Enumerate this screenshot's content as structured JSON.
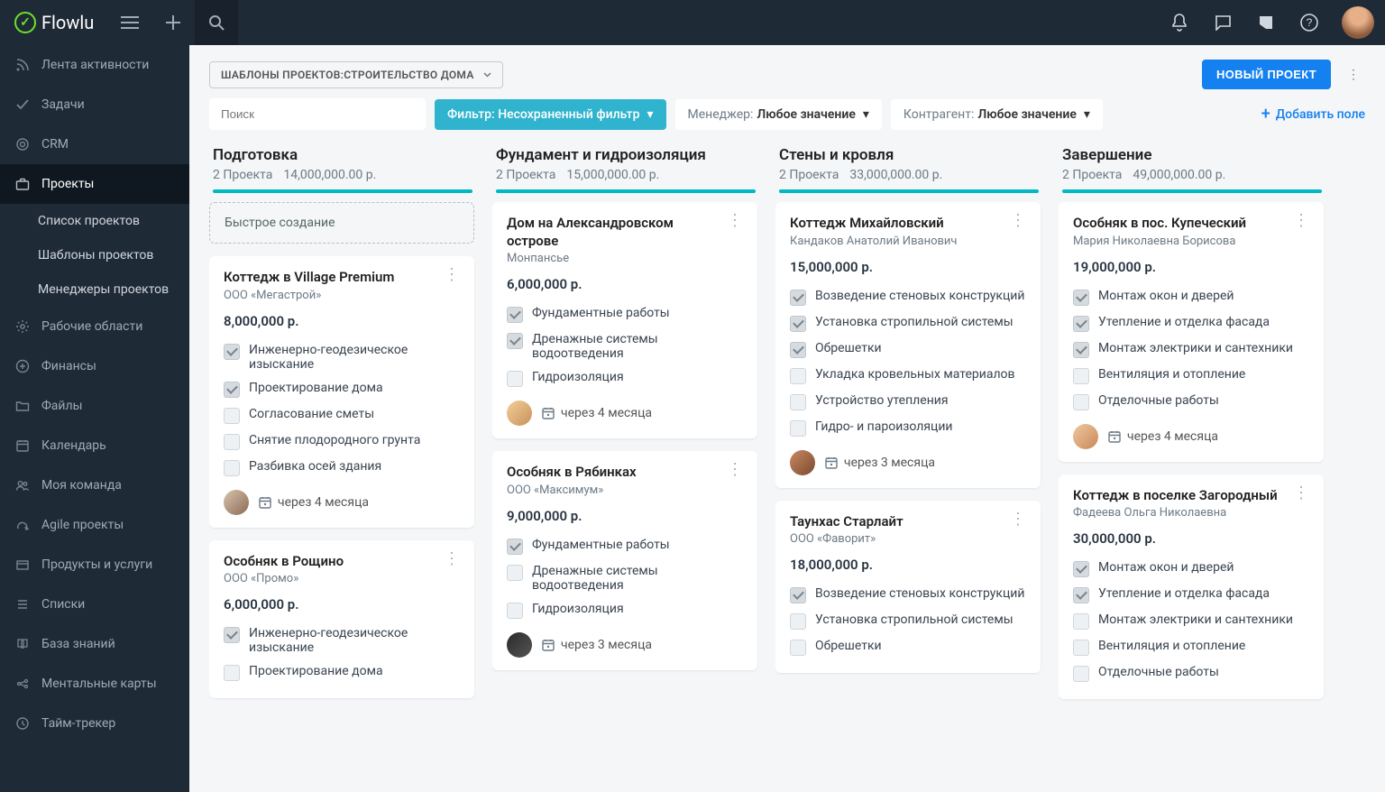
{
  "brand": "Flowlu",
  "sidebar": {
    "items": [
      {
        "label": "Лента активности",
        "icon": "rss"
      },
      {
        "label": "Задачи",
        "icon": "check"
      },
      {
        "label": "CRM",
        "icon": "target"
      },
      {
        "label": "Проекты",
        "icon": "briefcase",
        "active": true,
        "subs": [
          {
            "label": "Список проектов"
          },
          {
            "label": "Шаблоны проектов"
          },
          {
            "label": "Менеджеры проектов"
          }
        ]
      },
      {
        "label": "Рабочие области",
        "icon": "gear"
      },
      {
        "label": "Финансы",
        "icon": "plus-circle"
      },
      {
        "label": "Файлы",
        "icon": "folder"
      },
      {
        "label": "Календарь",
        "icon": "calendar"
      },
      {
        "label": "Моя команда",
        "icon": "users"
      },
      {
        "label": "Agile проекты",
        "icon": "agile"
      },
      {
        "label": "Продукты и услуги",
        "icon": "box"
      },
      {
        "label": "Списки",
        "icon": "list"
      },
      {
        "label": "База знаний",
        "icon": "book"
      },
      {
        "label": "Ментальные карты",
        "icon": "brain"
      },
      {
        "label": "Тайм-трекер",
        "icon": "clock"
      }
    ]
  },
  "toolbar": {
    "breadcrumb": "ШАБЛОНЫ ПРОЕКТОВ:СТРОИТЕЛЬСТВО ДОМА",
    "new_project": "НОВЫЙ ПРОЕКТ"
  },
  "filters": {
    "search_placeholder": "Поиск",
    "filter_label": "Фильтр: Несохраненный фильтр",
    "manager_label": "Менеджер:",
    "manager_value": "Любое значение",
    "counterparty_label": "Контрагент:",
    "counterparty_value": "Любое значение",
    "add_field": "Добавить поле"
  },
  "board": {
    "quick_create": "Быстрое создание",
    "columns": [
      {
        "title": "Подготовка",
        "count": "2 Проекта",
        "sum": "14,000,000.00 р.",
        "quick": true,
        "cards": [
          {
            "title": "Коттедж в Village Premium",
            "client": "ООО «Мегастрой»",
            "amount": "8,000,000 р.",
            "tasks": [
              {
                "t": "Инженерно-геодезическое изыскание",
                "done": true
              },
              {
                "t": "Проектирование дома",
                "done": true
              },
              {
                "t": "Согласование сметы",
                "done": false
              },
              {
                "t": "Снятие плодородного грунта",
                "done": false
              },
              {
                "t": "Разбивка осей здания",
                "done": false
              }
            ],
            "due": "через 4 месяца",
            "avatar": "a"
          },
          {
            "title": "Особняк в Рощино",
            "client": "ООО «Промо»",
            "amount": "6,000,000 р.",
            "tasks": [
              {
                "t": "Инженерно-геодезическое изыскание",
                "done": true
              },
              {
                "t": "Проектирование дома",
                "done": false
              }
            ]
          }
        ]
      },
      {
        "title": "Фундамент и гидроизоляция",
        "count": "2 Проекта",
        "sum": "15,000,000.00 р.",
        "cards": [
          {
            "title": "Дом на Александровском острове",
            "client": "Монпансье",
            "amount": "6,000,000 р.",
            "tasks": [
              {
                "t": "Фундаментные работы",
                "done": true
              },
              {
                "t": "Дренажные системы водоотведения",
                "done": true
              },
              {
                "t": "Гидроизоляция",
                "done": false
              }
            ],
            "due": "через 4 месяца",
            "avatar": "b"
          },
          {
            "title": "Особняк в Рябинках",
            "client": "ООО «Максимум»",
            "amount": "9,000,000 р.",
            "tasks": [
              {
                "t": "Фундаментные работы",
                "done": true
              },
              {
                "t": "Дренажные системы водоотведения",
                "done": false
              },
              {
                "t": "Гидроизоляция",
                "done": false
              }
            ],
            "due": "через 3 месяца",
            "avatar": "c"
          }
        ]
      },
      {
        "title": "Стены и кровля",
        "count": "2 Проекта",
        "sum": "33,000,000.00 р.",
        "cards": [
          {
            "title": "Коттедж Михайловский",
            "client": "Кандаков Анатолий Иванович",
            "amount": "15,000,000 р.",
            "tasks": [
              {
                "t": "Возведение стеновых конструкций",
                "done": true
              },
              {
                "t": "Установка стропильной системы",
                "done": true
              },
              {
                "t": "Обрешетки",
                "done": true
              },
              {
                "t": "Укладка кровельных материалов",
                "done": false
              },
              {
                "t": "Устройство утепления",
                "done": false
              },
              {
                "t": "Гидро- и пароизоляции",
                "done": false
              }
            ],
            "due": "через 3 месяца",
            "avatar": "d"
          },
          {
            "title": "Таунхас Старлайт",
            "client": "ООО «Фаворит»",
            "amount": "18,000,000 р.",
            "tasks": [
              {
                "t": "Возведение стеновых конструкций",
                "done": true
              },
              {
                "t": "Установка стропильной системы",
                "done": false
              },
              {
                "t": "Обрешетки",
                "done": false
              }
            ]
          }
        ]
      },
      {
        "title": "Завершение",
        "count": "2 Проекта",
        "sum": "49,000,000.00 р.",
        "cards": [
          {
            "title": "Особняк в пос. Купеческий",
            "client": "Мария Николаевна Борисова",
            "amount": "19,000,000 р.",
            "tasks": [
              {
                "t": "Монтаж окон и дверей",
                "done": true
              },
              {
                "t": "Утепление и отделка фасада",
                "done": true
              },
              {
                "t": "Монтаж электрики и сантехники",
                "done": true
              },
              {
                "t": "Вентиляция и отопление",
                "done": false
              },
              {
                "t": "Отделочные работы",
                "done": false
              }
            ],
            "due": "через 4 месяца",
            "avatar": "e"
          },
          {
            "title": "Коттедж в поселке Загородный",
            "client": "Фадеева Ольга Николаевна",
            "amount": "30,000,000 р.",
            "tasks": [
              {
                "t": "Монтаж окон и дверей",
                "done": true
              },
              {
                "t": "Утепление и отделка фасада",
                "done": true
              },
              {
                "t": "Монтаж электрики и сантехники",
                "done": false
              },
              {
                "t": "Вентиляция и отопление",
                "done": false
              },
              {
                "t": "Отделочные работы",
                "done": false
              }
            ]
          }
        ]
      }
    ]
  },
  "avatars": {
    "a": "linear-gradient(135deg,#d8c4b0,#8a6a52)",
    "b": "linear-gradient(135deg,#f2d09a,#c9905a)",
    "c": "linear-gradient(135deg,#2a2a2a,#555)",
    "d": "linear-gradient(135deg,#c98860,#7a4a30)",
    "e": "linear-gradient(135deg,#f0c8a0,#c88858)"
  }
}
